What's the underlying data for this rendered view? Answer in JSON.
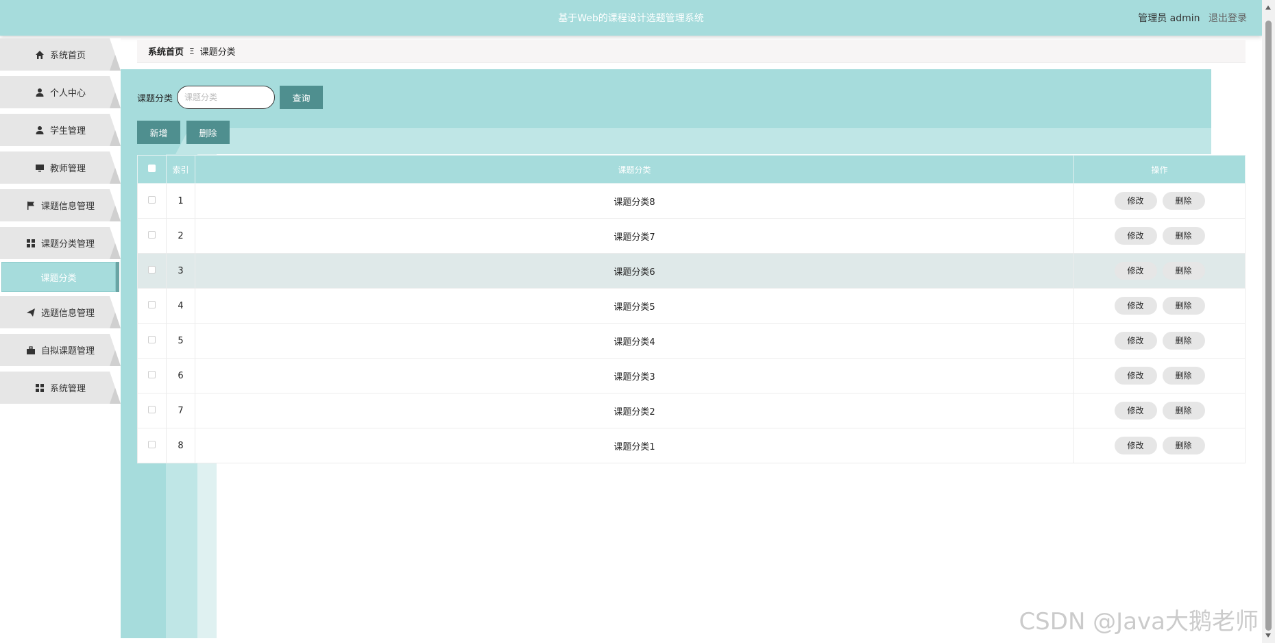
{
  "header": {
    "title": "基于Web的课程设计选题管理系统",
    "role_label": "管理员 admin",
    "logout_label": "退出登录"
  },
  "sidebar": {
    "items": [
      {
        "label": "系统首页",
        "icon": "home-icon"
      },
      {
        "label": "个人中心",
        "icon": "user-icon"
      },
      {
        "label": "学生管理",
        "icon": "user-icon"
      },
      {
        "label": "教师管理",
        "icon": "monitor-icon"
      },
      {
        "label": "课题信息管理",
        "icon": "flag-icon"
      },
      {
        "label": "课题分类管理",
        "icon": "grid-icon"
      },
      {
        "label": "选题信息管理",
        "icon": "send-icon"
      },
      {
        "label": "自拟课题管理",
        "icon": "briefcase-icon"
      },
      {
        "label": "系统管理",
        "icon": "grid-icon"
      }
    ],
    "active_sub": "课题分类"
  },
  "breadcrumb": {
    "home": "系统首页",
    "separator": "Ξ",
    "current": "课题分类"
  },
  "search": {
    "label": "课题分类",
    "placeholder": "课题分类",
    "button": "查询"
  },
  "actions": {
    "add": "新增",
    "delete": "删除"
  },
  "table": {
    "columns": [
      "索引",
      "课题分类",
      "操作"
    ],
    "edit_label": "修改",
    "delete_label": "删除",
    "rows": [
      {
        "index": "1",
        "category": "课题分类8"
      },
      {
        "index": "2",
        "category": "课题分类7"
      },
      {
        "index": "3",
        "category": "课题分类6"
      },
      {
        "index": "4",
        "category": "课题分类5"
      },
      {
        "index": "5",
        "category": "课题分类4"
      },
      {
        "index": "6",
        "category": "课题分类3"
      },
      {
        "index": "7",
        "category": "课题分类2"
      },
      {
        "index": "8",
        "category": "课题分类1"
      }
    ]
  },
  "watermark": "CSDN @Java大鹅老师",
  "colors": {
    "accent": "#a6dcdc",
    "button": "#4f8f8f",
    "highlight_row": "#dfe9e9"
  }
}
